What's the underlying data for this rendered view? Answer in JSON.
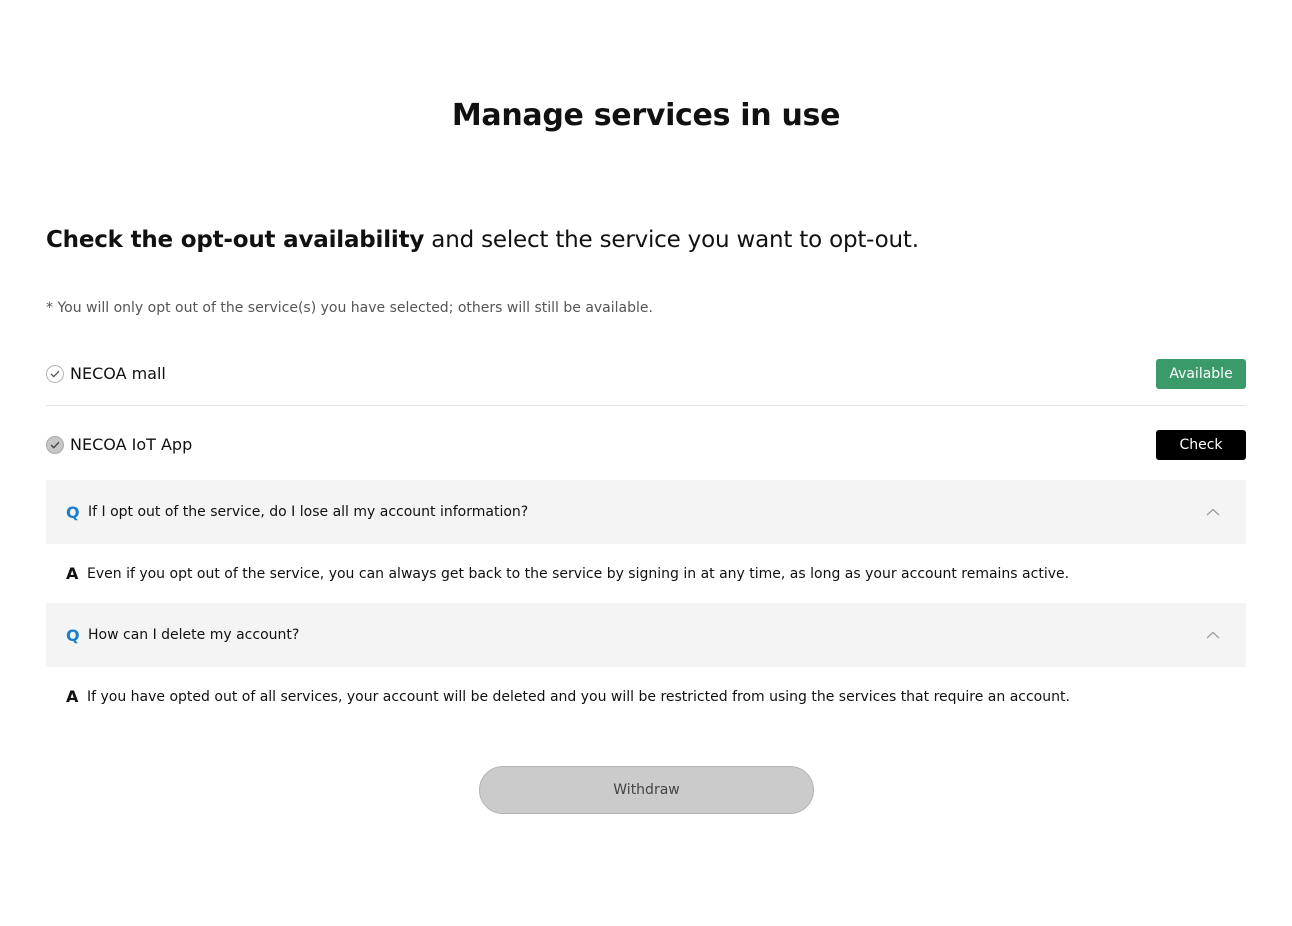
{
  "page": {
    "title": "Manage services in use",
    "subtitle_bold": "Check the opt-out availability",
    "subtitle_rest": " and select the service you want to opt-out.",
    "note": "* You will only opt out of the service(s) you have selected; others will still be available."
  },
  "services": [
    {
      "name": "NECOA mall",
      "status_label": "Available",
      "status_color": "#3a9a6a",
      "check_icon": "check-circle-icon"
    },
    {
      "name": "NECOA IoT App",
      "status_label": "Check",
      "status_color": "#000000",
      "check_icon": "check-circle-icon"
    }
  ],
  "faq": [
    {
      "q_marker": "Q",
      "question": "If I opt out of the service, do I lose all my account information?",
      "a_marker": "A",
      "answer": "Even if you opt out of the service, you can always get back to the service by signing in at any time, as long as your account remains active.",
      "toggle_icon": "chevron-up-icon"
    },
    {
      "q_marker": "Q",
      "question": "How can I delete my account?",
      "a_marker": "A",
      "answer": "If you have opted out of all services, your account will be deleted and you will be restricted from using the services that require an account.",
      "toggle_icon": "chevron-up-icon"
    }
  ],
  "withdraw_button": {
    "label": "Withdraw",
    "state": "disabled"
  },
  "colors": {
    "accent_blue": "#1a7fd0",
    "available_green": "#3a9a6a",
    "faq_bg": "#f4f4f4",
    "withdraw_bg": "#cbcbcb"
  }
}
